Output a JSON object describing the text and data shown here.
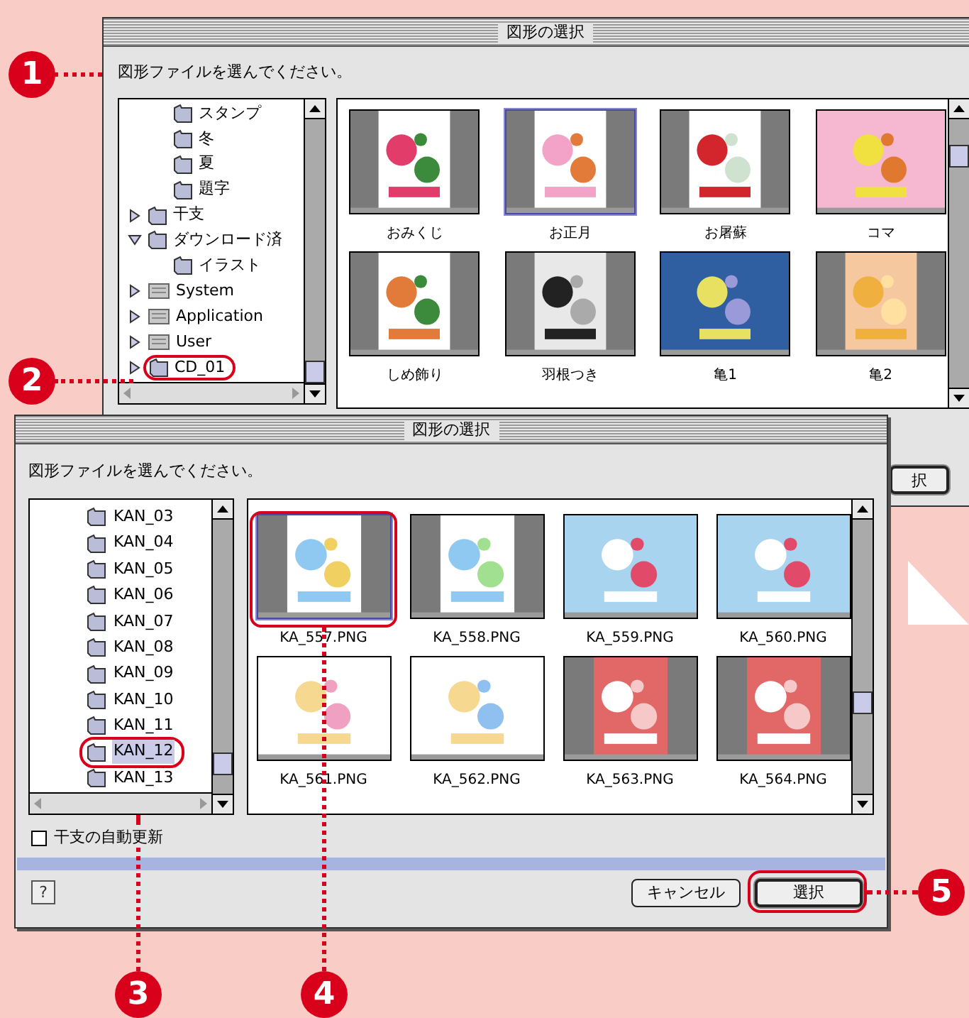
{
  "back_window": {
    "title": "図形の選択",
    "instruction": "図形ファイルを選んでください。",
    "tree": {
      "partial_children": [
        {
          "label": "スタンプ"
        },
        {
          "label": "冬"
        },
        {
          "label": "夏"
        },
        {
          "label": "題字"
        }
      ],
      "items": [
        {
          "label": "干支",
          "kind": "folder",
          "expanded": false,
          "selected": false
        },
        {
          "label": "ダウンロード済",
          "kind": "folder",
          "expanded": true,
          "selected": false,
          "children": [
            {
              "label": "イラスト",
              "kind": "folder",
              "selected": false
            }
          ]
        },
        {
          "label": "System",
          "kind": "disk",
          "expanded": false,
          "selected": false
        },
        {
          "label": "Application",
          "kind": "disk",
          "expanded": false,
          "selected": false
        },
        {
          "label": "User",
          "kind": "disk",
          "expanded": false,
          "selected": false
        },
        {
          "label": "CD_01",
          "kind": "folder",
          "expanded": false,
          "selected": false,
          "circled": true
        }
      ]
    },
    "thumbnails": [
      {
        "label": "おみくじ",
        "selected": false
      },
      {
        "label": "お正月",
        "selected": true
      },
      {
        "label": "お屠蘇",
        "selected": false
      },
      {
        "label": "コマ",
        "selected": false
      },
      {
        "label": "しめ飾り",
        "selected": false
      },
      {
        "label": "羽根つき",
        "selected": false
      },
      {
        "label": "亀1",
        "selected": false
      },
      {
        "label": "亀2",
        "selected": false
      }
    ],
    "buttons": [
      {
        "label": "択",
        "default": true
      }
    ]
  },
  "front_window": {
    "title": "図形の選択",
    "instruction": "図形ファイルを選んでください。",
    "tree": {
      "items": [
        {
          "label": "KAN_03",
          "selected": false
        },
        {
          "label": "KAN_04",
          "selected": false
        },
        {
          "label": "KAN_05",
          "selected": false
        },
        {
          "label": "KAN_06",
          "selected": false
        },
        {
          "label": "KAN_07",
          "selected": false
        },
        {
          "label": "KAN_08",
          "selected": false
        },
        {
          "label": "KAN_09",
          "selected": false
        },
        {
          "label": "KAN_10",
          "selected": false
        },
        {
          "label": "KAN_11",
          "selected": false
        },
        {
          "label": "KAN_12",
          "selected": true,
          "circled": true
        },
        {
          "label": "KAN_13",
          "selected": false
        }
      ]
    },
    "thumbnails": [
      {
        "label": "KA_557.PNG",
        "selected": true
      },
      {
        "label": "KA_558.PNG",
        "selected": false
      },
      {
        "label": "KA_559.PNG",
        "selected": false
      },
      {
        "label": "KA_560.PNG",
        "selected": false
      },
      {
        "label": "KA_561.PNG",
        "selected": false
      },
      {
        "label": "KA_562.PNG",
        "selected": false
      },
      {
        "label": "KA_563.PNG",
        "selected": false
      },
      {
        "label": "KA_564.PNG",
        "selected": false
      }
    ],
    "checkbox": {
      "label": "干支の自動更新",
      "checked": false
    },
    "help_button": "?",
    "buttons": [
      {
        "label": "キャンセル",
        "default": false
      },
      {
        "label": "選択",
        "default": true
      }
    ]
  },
  "callouts": [
    {
      "number": "1"
    },
    {
      "number": "2"
    },
    {
      "number": "3"
    },
    {
      "number": "4"
    },
    {
      "number": "5"
    }
  ]
}
